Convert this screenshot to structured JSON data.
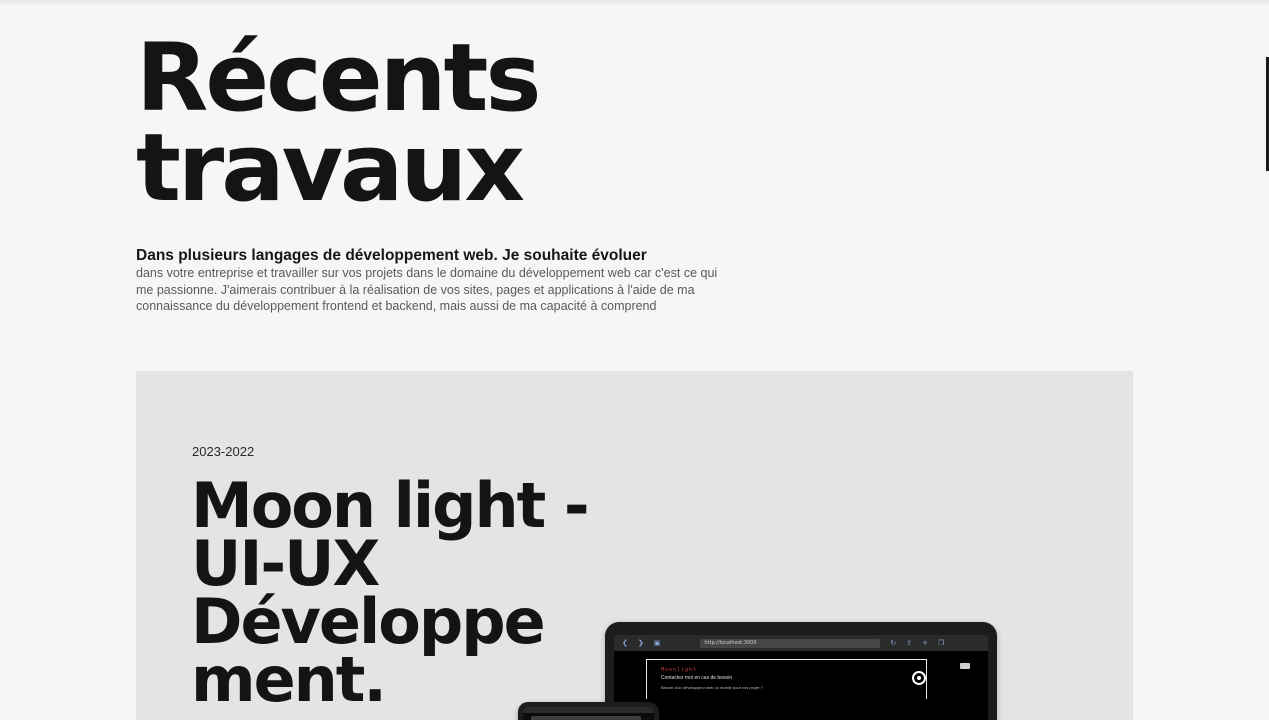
{
  "hero": {
    "title_line1": "Récents",
    "title_line2": "travaux"
  },
  "intro": {
    "lead": "Dans plusieurs langages de développement web. Je souhaite évoluer",
    "body": "dans votre entreprise et travailler sur vos projets dans le domaine du développement web car c'est ce qui me passionne. J'aimerais contribuer à la réalisation de vos sites, pages et applications à l'aide de ma connaissance du développement frontend et backend, mais aussi de ma capacité à comprend"
  },
  "project": {
    "years": "2023-2022",
    "title_line1": "Moon light -",
    "title_line2": "UI-UX",
    "title_line3": "Développe",
    "title_line4": "ment.",
    "mockup": {
      "url": "http://localhost:3000",
      "brand": "Moonlight",
      "heading": "Contactez moi en cas de besoin",
      "subtext": "Besoin d'un développeur web ou mobile pour vos projet ?"
    }
  },
  "colors": {
    "page_background": "#f6f6f6",
    "card_background": "#e4e4e4",
    "text_primary": "#141414",
    "accent_red": "#d13b3b"
  }
}
